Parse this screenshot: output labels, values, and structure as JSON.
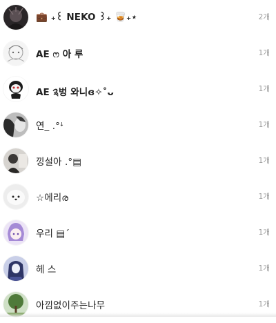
{
  "chat_list": {
    "items": [
      {
        "name": "💼 ₊꒰ NEKO ꒱₊ 🥃₊⋆",
        "count": "2개"
      },
      {
        "name": "AE ෆ 아 루",
        "count": "1개"
      },
      {
        "name": "AE ༉벙 와니ɞ✧˚ᴗ",
        "count": "1개"
      },
      {
        "name": "연_ .°ꜜ",
        "count": "1개"
      },
      {
        "name": "낑설아 .°▤",
        "count": "1개"
      },
      {
        "name": "☆에리ര",
        "count": "1개"
      },
      {
        "name": "우리 ▤ˊ",
        "count": "1개"
      },
      {
        "name": "헤 스",
        "count": "1개"
      },
      {
        "name": "아낌없이주는나무",
        "count": "1개"
      }
    ]
  }
}
